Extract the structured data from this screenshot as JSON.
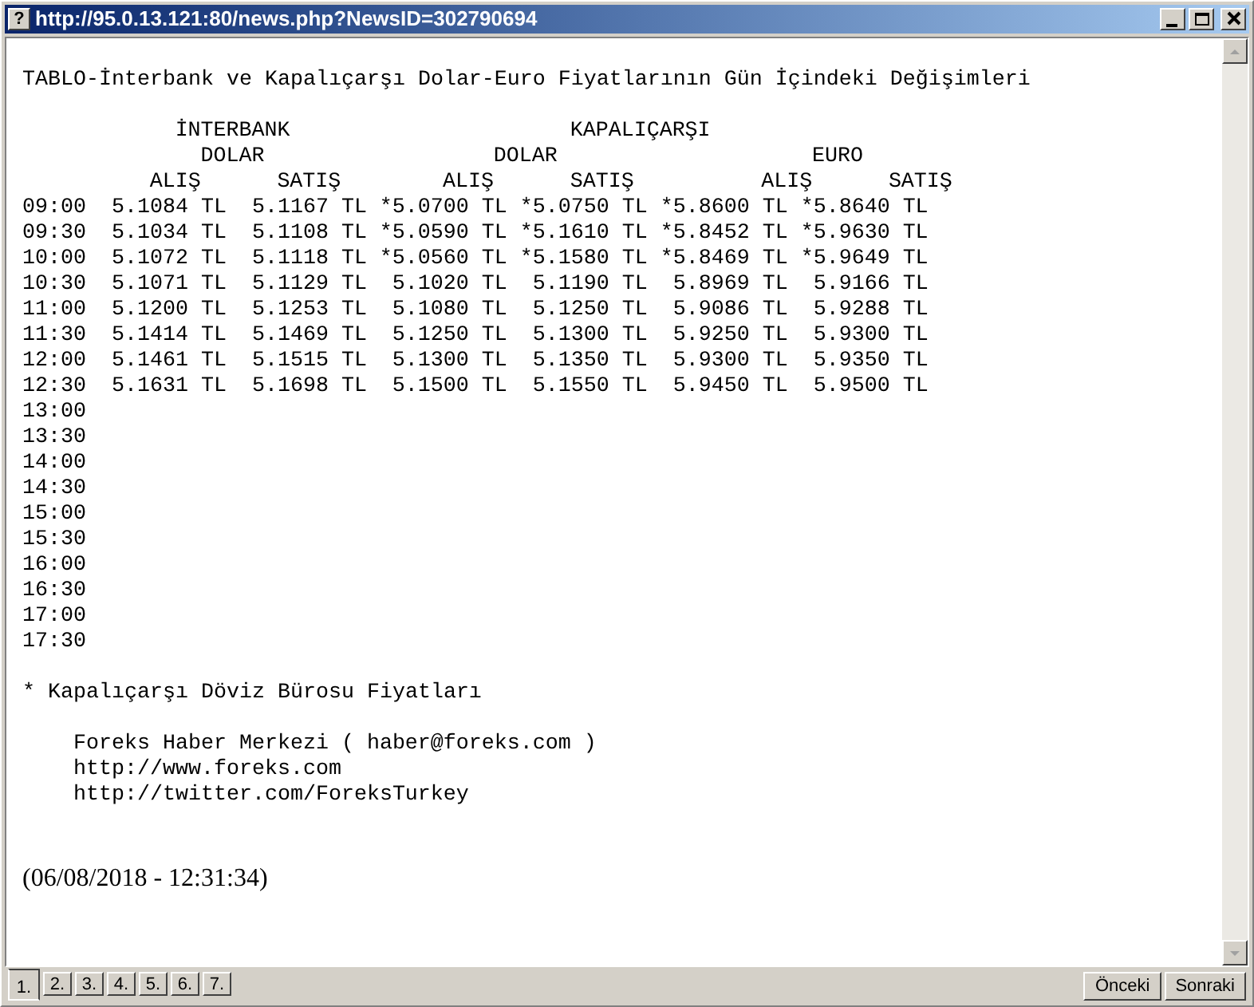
{
  "window": {
    "title": "http://95.0.13.121:80/news.php?NewsID=302790694",
    "help_glyph": "?"
  },
  "article": {
    "title": "TABLO-İnterbank ve Kapalıçarşı Dolar-Euro Fiyatlarının Gün İçindeki Değişimleri",
    "group_headers": [
      "İNTERBANK",
      "KAPALIÇARŞI"
    ],
    "currency_headers": [
      "DOLAR",
      "DOLAR",
      "EURO"
    ],
    "column_headers": [
      "ALIŞ",
      "SATIŞ",
      "ALIŞ",
      "SATIŞ",
      "ALIŞ",
      "SATIŞ"
    ],
    "rows": [
      {
        "time": "09:00",
        "values": [
          "5.1084 TL",
          "5.1167 TL",
          "*5.0700 TL",
          "*5.0750 TL",
          "*5.8600 TL",
          "*5.8640 TL"
        ]
      },
      {
        "time": "09:30",
        "values": [
          "5.1034 TL",
          "5.1108 TL",
          "*5.0590 TL",
          "*5.1610 TL",
          "*5.8452 TL",
          "*5.9630 TL"
        ]
      },
      {
        "time": "10:00",
        "values": [
          "5.1072 TL",
          "5.1118 TL",
          "*5.0560 TL",
          "*5.1580 TL",
          "*5.8469 TL",
          "*5.9649 TL"
        ]
      },
      {
        "time": "10:30",
        "values": [
          "5.1071 TL",
          "5.1129 TL",
          "5.1020 TL",
          "5.1190 TL",
          "5.8969 TL",
          "5.9166 TL"
        ]
      },
      {
        "time": "11:00",
        "values": [
          "5.1200 TL",
          "5.1253 TL",
          "5.1080 TL",
          "5.1250 TL",
          "5.9086 TL",
          "5.9288 TL"
        ]
      },
      {
        "time": "11:30",
        "values": [
          "5.1414 TL",
          "5.1469 TL",
          "5.1250 TL",
          "5.1300 TL",
          "5.9250 TL",
          "5.9300 TL"
        ]
      },
      {
        "time": "12:00",
        "values": [
          "5.1461 TL",
          "5.1515 TL",
          "5.1300 TL",
          "5.1350 TL",
          "5.9300 TL",
          "5.9350 TL"
        ]
      },
      {
        "time": "12:30",
        "values": [
          "5.1631 TL",
          "5.1698 TL",
          "5.1500 TL",
          "5.1550 TL",
          "5.9450 TL",
          "5.9500 TL"
        ]
      },
      {
        "time": "13:00",
        "values": []
      },
      {
        "time": "13:30",
        "values": []
      },
      {
        "time": "14:00",
        "values": []
      },
      {
        "time": "14:30",
        "values": []
      },
      {
        "time": "15:00",
        "values": []
      },
      {
        "time": "15:30",
        "values": []
      },
      {
        "time": "16:00",
        "values": []
      },
      {
        "time": "16:30",
        "values": []
      },
      {
        "time": "17:00",
        "values": []
      },
      {
        "time": "17:30",
        "values": []
      }
    ],
    "footnote": "* Kapalıçarşı Döviz Bürosu Fiyatları",
    "source_lines": [
      "Foreks Haber Merkezi ( haber@foreks.com )",
      "http://www.foreks.com",
      "http://twitter.com/ForeksTurkey"
    ],
    "timestamp": "(06/08/2018 - 12:31:34)"
  },
  "pages": [
    {
      "label": "1.",
      "selected": true
    },
    {
      "label": "2.",
      "selected": false
    },
    {
      "label": "3.",
      "selected": false
    },
    {
      "label": "4.",
      "selected": false
    },
    {
      "label": "5.",
      "selected": false
    },
    {
      "label": "6.",
      "selected": false
    },
    {
      "label": "7.",
      "selected": false
    }
  ],
  "buttons": [
    "Önceki",
    "Sonraki"
  ]
}
